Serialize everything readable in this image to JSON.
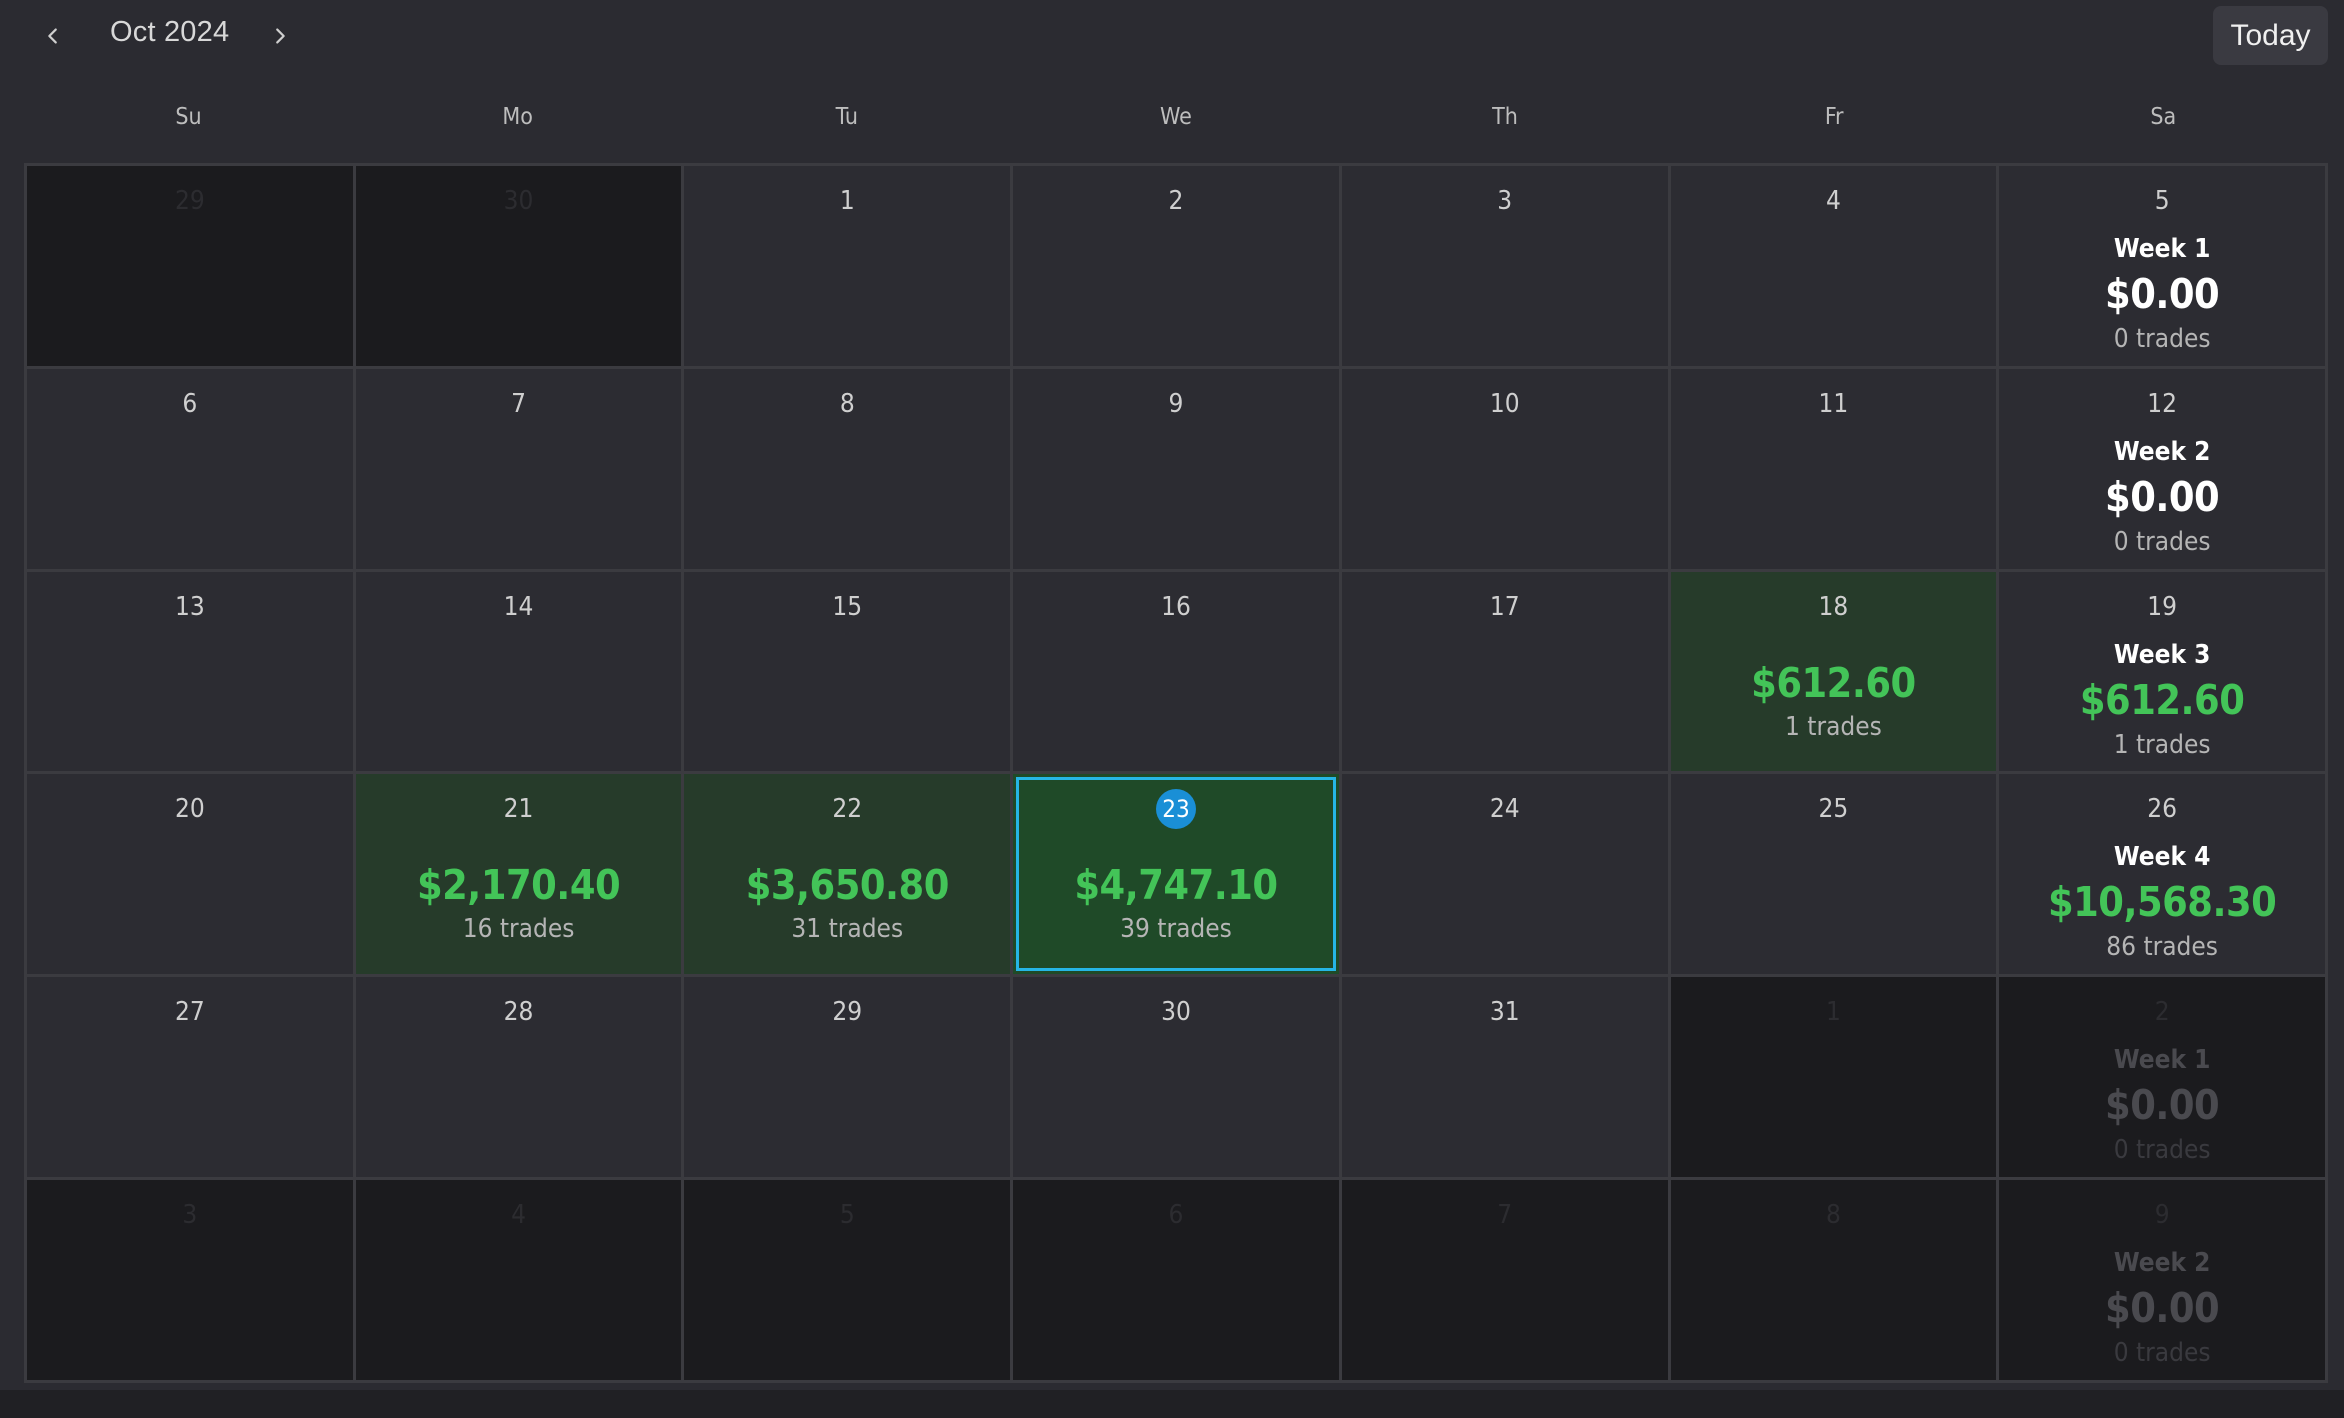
{
  "header": {
    "month_label": "Oct 2024",
    "today_label": "Today",
    "prev_icon": "chevron-left-icon",
    "next_icon": "chevron-right-icon"
  },
  "weekdays": [
    "Su",
    "Mo",
    "Tu",
    "We",
    "Th",
    "Fr",
    "Sa"
  ],
  "colors": {
    "profit": "#43c458",
    "today_badge": "#1a8fd6",
    "selected_border": "#26b6e6"
  },
  "weeks": [
    {
      "days": [
        {
          "day": "29",
          "outside": true
        },
        {
          "day": "30",
          "outside": true
        },
        {
          "day": "1"
        },
        {
          "day": "2"
        },
        {
          "day": "3"
        },
        {
          "day": "4"
        },
        {
          "day": "5",
          "summary": {
            "label": "Week 1",
            "pnl": "$0.00",
            "trades": "0 trades"
          }
        }
      ]
    },
    {
      "days": [
        {
          "day": "6"
        },
        {
          "day": "7"
        },
        {
          "day": "8"
        },
        {
          "day": "9"
        },
        {
          "day": "10"
        },
        {
          "day": "11"
        },
        {
          "day": "12",
          "summary": {
            "label": "Week 2",
            "pnl": "$0.00",
            "trades": "0 trades"
          }
        }
      ]
    },
    {
      "days": [
        {
          "day": "13"
        },
        {
          "day": "14"
        },
        {
          "day": "15"
        },
        {
          "day": "16"
        },
        {
          "day": "17"
        },
        {
          "day": "18",
          "pnl": "$612.60",
          "trades": "1 trades"
        },
        {
          "day": "19",
          "summary": {
            "label": "Week 3",
            "pnl": "$612.60",
            "trades": "1 trades",
            "positive": true
          }
        }
      ]
    },
    {
      "days": [
        {
          "day": "20"
        },
        {
          "day": "21",
          "pnl": "$2,170.40",
          "trades": "16 trades"
        },
        {
          "day": "22",
          "pnl": "$3,650.80",
          "trades": "31 trades"
        },
        {
          "day": "23",
          "pnl": "$4,747.10",
          "trades": "39 trades",
          "today": true,
          "selected": true
        },
        {
          "day": "24"
        },
        {
          "day": "25"
        },
        {
          "day": "26",
          "summary": {
            "label": "Week 4",
            "pnl": "$10,568.30",
            "trades": "86 trades",
            "positive": true
          }
        }
      ]
    },
    {
      "days": [
        {
          "day": "27"
        },
        {
          "day": "28"
        },
        {
          "day": "29"
        },
        {
          "day": "30"
        },
        {
          "day": "31"
        },
        {
          "day": "1",
          "outside": true
        },
        {
          "day": "2",
          "outside": true,
          "summary": {
            "label": "Week 1",
            "pnl": "$0.00",
            "trades": "0 trades"
          }
        }
      ]
    },
    {
      "days": [
        {
          "day": "3",
          "outside": true
        },
        {
          "day": "4",
          "outside": true
        },
        {
          "day": "5",
          "outside": true
        },
        {
          "day": "6",
          "outside": true
        },
        {
          "day": "7",
          "outside": true
        },
        {
          "day": "8",
          "outside": true
        },
        {
          "day": "9",
          "outside": true,
          "summary": {
            "label": "Week 2",
            "pnl": "$0.00",
            "trades": "0 trades"
          }
        }
      ]
    }
  ]
}
